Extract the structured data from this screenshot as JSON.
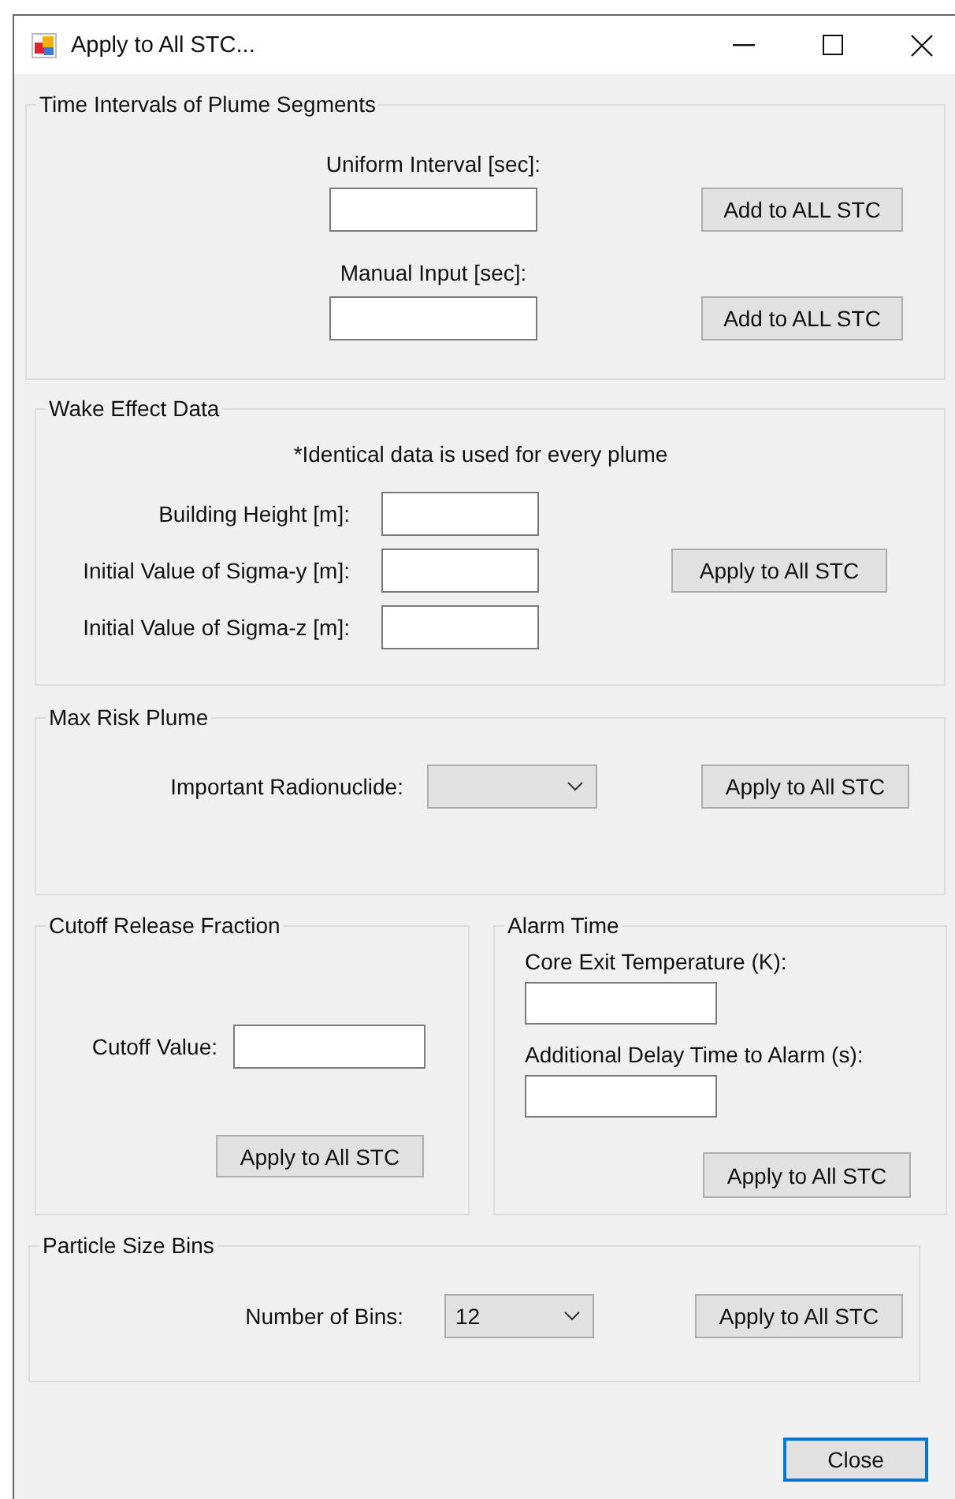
{
  "window": {
    "title": "Apply to All STC..."
  },
  "time_intervals": {
    "title": "Time Intervals of Plume Segments",
    "rows": [
      {
        "label": "Uniform Interval [sec]:",
        "button": "Add to ALL STC"
      },
      {
        "label": "Manual Input [sec]:",
        "button": "Add to ALL STC"
      }
    ]
  },
  "wake_effect": {
    "title": "Wake Effect Data",
    "note": "*Identical data is used for every plume",
    "fields": [
      {
        "label": "Building Height [m]:"
      },
      {
        "label": "Initial Value of Sigma-y [m]:"
      },
      {
        "label": "Initial Value of Sigma-z [m]:"
      }
    ],
    "button": "Apply to All STC"
  },
  "max_risk_plume": {
    "title": "Max Risk Plume",
    "label": "Important Radionuclide:",
    "button": "Apply to All STC"
  },
  "cutoff_release_fraction": {
    "title": "Cutoff Release Fraction",
    "label": "Cutoff Value:",
    "button": "Apply to All STC"
  },
  "alarm_time": {
    "title": "Alarm Time",
    "fields": [
      {
        "label": "Core Exit Temperature (K):"
      },
      {
        "label": "Additional Delay Time to Alarm (s):"
      }
    ],
    "button": "Apply to All STC"
  },
  "particle_size_bins": {
    "title": "Particle Size Bins",
    "label": "Number of Bins:",
    "dropdown": {
      "value": "12"
    },
    "button": "Apply to All STC"
  },
  "close_button": {
    "label": "Close",
    "focused": true
  }
}
